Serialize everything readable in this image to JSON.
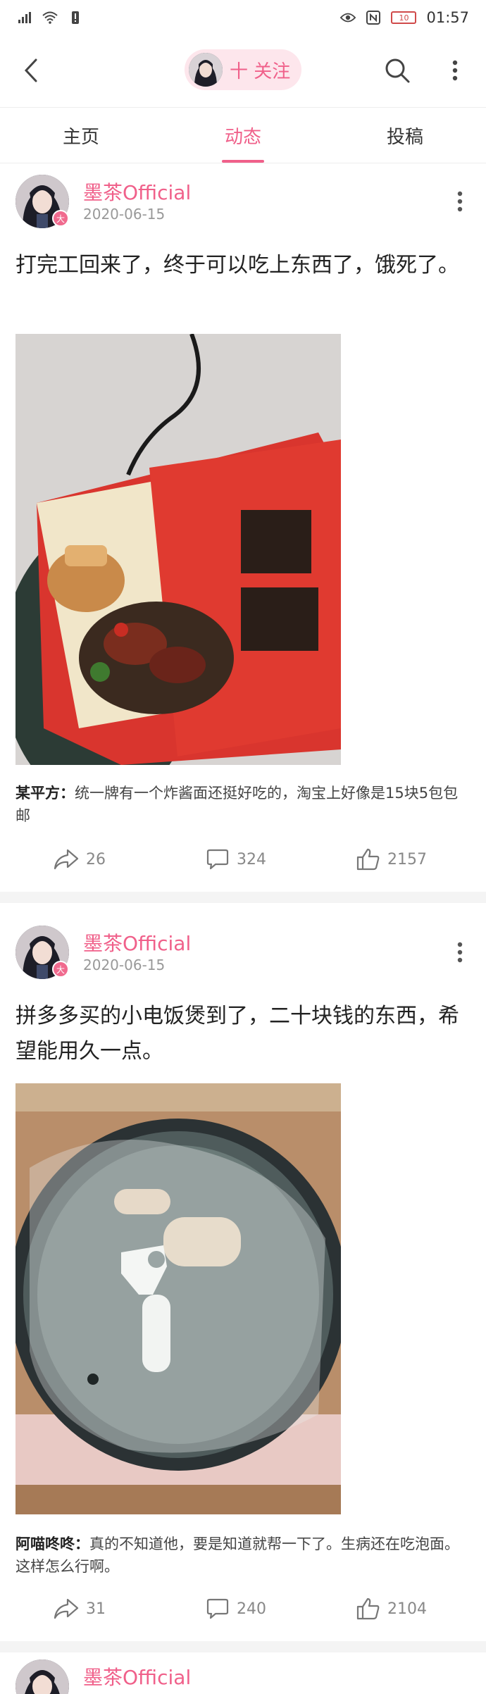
{
  "status": {
    "time": "01:57",
    "battery": "10"
  },
  "header": {
    "follow_label": "十 关注"
  },
  "tabs": [
    {
      "label": "主页"
    },
    {
      "label": "动态"
    },
    {
      "label": "投稿"
    }
  ],
  "posts": [
    {
      "author": "墨茶Official",
      "date": "2020-06-15",
      "text": "打完工回来了，终于可以吃上东西了，饿死了。",
      "image_alt": "卤肉面",
      "comment_user": "某平方：",
      "comment_text": "统一牌有一个炸酱面还挺好吃的，淘宝上好像是15块5包包邮",
      "share": "26",
      "comments": "324",
      "likes": "2157"
    },
    {
      "author": "墨茶Official",
      "date": "2020-06-15",
      "text": "拼多多买的小电饭煲到了，二十块钱的东西，希望能用久一点。",
      "comment_user": "阿喵咚咚：",
      "comment_text": "真的不知道他，要是知道就帮一下了。生病还在吃泡面。这样怎么行啊。",
      "share": "31",
      "comments": "240",
      "likes": "2104"
    },
    {
      "author": "墨茶Official"
    }
  ],
  "colors": {
    "accent": "#f0608a",
    "pill_bg": "#fde6ec"
  }
}
